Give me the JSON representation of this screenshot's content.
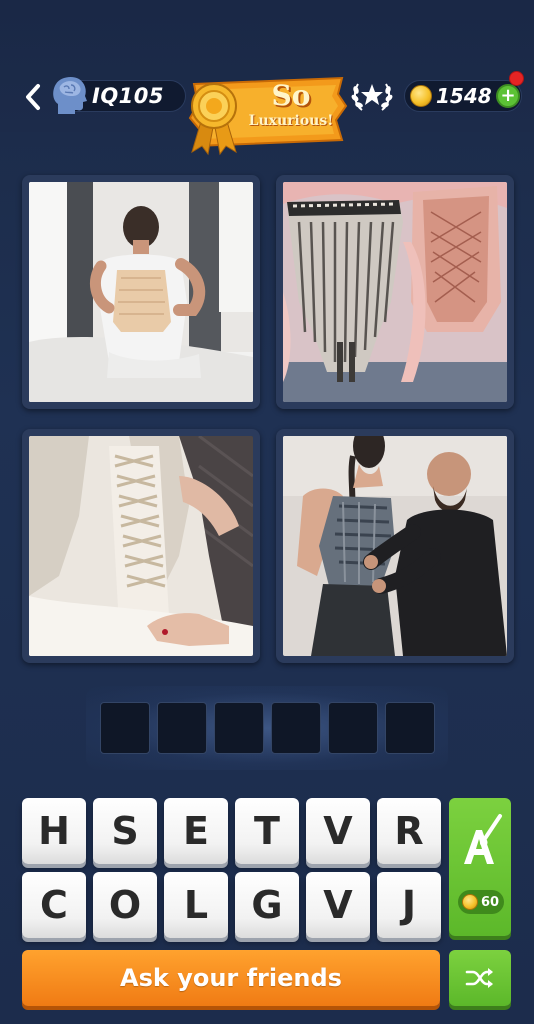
{
  "header": {
    "iq_label": "IQ",
    "iq_value": "105",
    "badge_line1": "So",
    "badge_line2": "Luxurious!",
    "coins": "1548",
    "plus": "+"
  },
  "puzzle": {
    "answer_length": 6,
    "letters_row1": [
      "H",
      "S",
      "E",
      "T",
      "V",
      "R"
    ],
    "letters_row2": [
      "C",
      "O",
      "L",
      "G",
      "V",
      "J"
    ],
    "hint_cost": "60"
  },
  "actions": {
    "ask_friends": "Ask your friends"
  },
  "colors": {
    "background": "#1f3153",
    "key_face": "#ffffff",
    "hint_green": "#5cb82a",
    "ask_orange": "#f07b14",
    "badge_orange": "#f39a1b"
  },
  "icons": {
    "back": "chevron-left-icon",
    "iq": "brain-head-icon",
    "ribbon": "rosette-ribbon-icon",
    "rank": "laurel-star-icon",
    "coin": "coin-icon",
    "add": "plus-icon",
    "hint": "letter-brush-icon",
    "shuffle": "shuffle-icon"
  }
}
